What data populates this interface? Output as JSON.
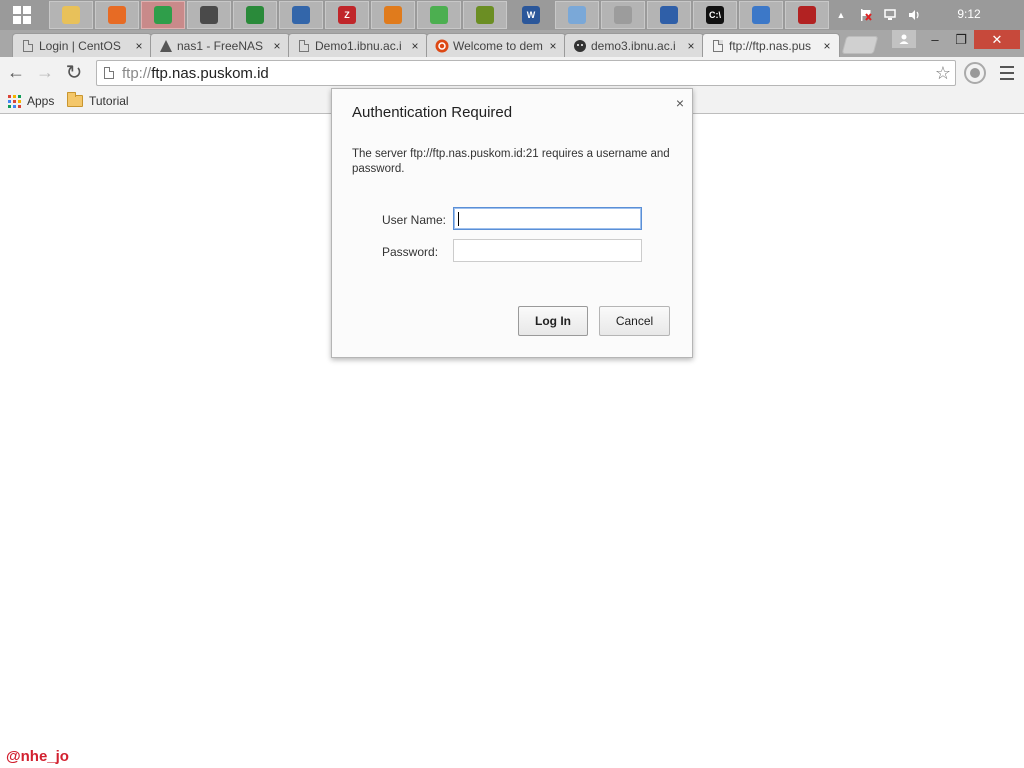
{
  "taskbar": {
    "start_icon": "windows-logo-icon",
    "apps": [
      {
        "name": "file-explorer",
        "icon": "folder-icon",
        "color": "#e8c15a",
        "glyph": ""
      },
      {
        "name": "firefox",
        "icon": "firefox-icon",
        "color": "#e76b24",
        "glyph": ""
      },
      {
        "name": "chrome",
        "icon": "chrome-icon",
        "color": "#2f9e4a",
        "glyph": ""
      },
      {
        "name": "network-tool",
        "icon": "network-icon",
        "color": "#4a4a4a",
        "glyph": ""
      },
      {
        "name": "app-5",
        "icon": "app-icon",
        "color": "#2a8a3a",
        "glyph": ""
      },
      {
        "name": "virtualbox",
        "icon": "virtualbox-icon",
        "color": "#3366aa",
        "glyph": ""
      },
      {
        "name": "filezilla",
        "icon": "filezilla-icon",
        "color": "#c0262a",
        "glyph": "Z"
      },
      {
        "name": "app-8",
        "icon": "app-icon",
        "color": "#e07b1c",
        "glyph": ""
      },
      {
        "name": "app-9",
        "icon": "app-icon",
        "color": "#4caf50",
        "glyph": ""
      },
      {
        "name": "app-10",
        "icon": "app-icon",
        "color": "#6b8e23",
        "glyph": ""
      },
      {
        "name": "word",
        "icon": "word-icon",
        "color": "#2b579a",
        "glyph": "W"
      },
      {
        "name": "paint",
        "icon": "paint-icon",
        "color": "#7aa8d8",
        "glyph": ""
      },
      {
        "name": "app-13",
        "icon": "app-icon",
        "color": "#9c9c9c",
        "glyph": ""
      },
      {
        "name": "remote-desktop",
        "icon": "remote-desktop-icon",
        "color": "#2f5fa8",
        "glyph": ""
      },
      {
        "name": "command-prompt",
        "icon": "terminal-icon",
        "color": "#111111",
        "glyph": "C:\\"
      },
      {
        "name": "app-16",
        "icon": "app-icon",
        "color": "#3c78c8",
        "glyph": ""
      },
      {
        "name": "app-17",
        "icon": "app-icon",
        "color": "#b22222",
        "glyph": ""
      }
    ],
    "tray": {
      "chevron_icon": "chevron-up-icon",
      "flag_icon": "action-center-flag-icon",
      "network_icon": "network-status-icon",
      "volume_icon": "volume-icon"
    },
    "clock": "9:12"
  },
  "tabs": [
    {
      "title": "Login | CentOS",
      "favicon": "page-icon",
      "close": "×",
      "active": false
    },
    {
      "title": "nas1 - FreeNAS",
      "favicon": "freenas-shark-icon",
      "close": "×",
      "active": false
    },
    {
      "title": "Demo1.ibnu.ac.i",
      "favicon": "page-icon",
      "close": "×",
      "active": false
    },
    {
      "title": "Welcome to dem",
      "favicon": "ubuntu-logo-icon",
      "close": "×",
      "active": false
    },
    {
      "title": "demo3.ibnu.ac.i",
      "favicon": "github-cat-icon",
      "close": "×",
      "active": false
    },
    {
      "title": "ftp://ftp.nas.pus",
      "favicon": "page-icon",
      "close": "×",
      "active": true
    }
  ],
  "window_controls": {
    "minimize": "–",
    "restore": "❐",
    "close": "✕"
  },
  "toolbar": {
    "back": "←",
    "forward": "→",
    "reload": "↻",
    "url_scheme": "ftp://",
    "url_host": "ftp.nas.puskom.id",
    "bookmark_star": "☆"
  },
  "bookmarks": [
    {
      "label": "Apps",
      "icon": "apps-grid-icon"
    },
    {
      "label": "Tutorial",
      "icon": "folder-icon"
    }
  ],
  "dialog": {
    "title": "Authentication Required",
    "close": "×",
    "message": "The server ftp://ftp.nas.puskom.id:21 requires a username and password.",
    "username_label": "User Name:",
    "username_value": "",
    "password_label": "Password:",
    "password_value": "",
    "login_button": "Log In",
    "cancel_button": "Cancel"
  },
  "watermark": "@nhe_jo",
  "colors": {
    "accent_close": "#c7493b",
    "focus_border": "#5a8fd6",
    "watermark": "#d2202f"
  }
}
